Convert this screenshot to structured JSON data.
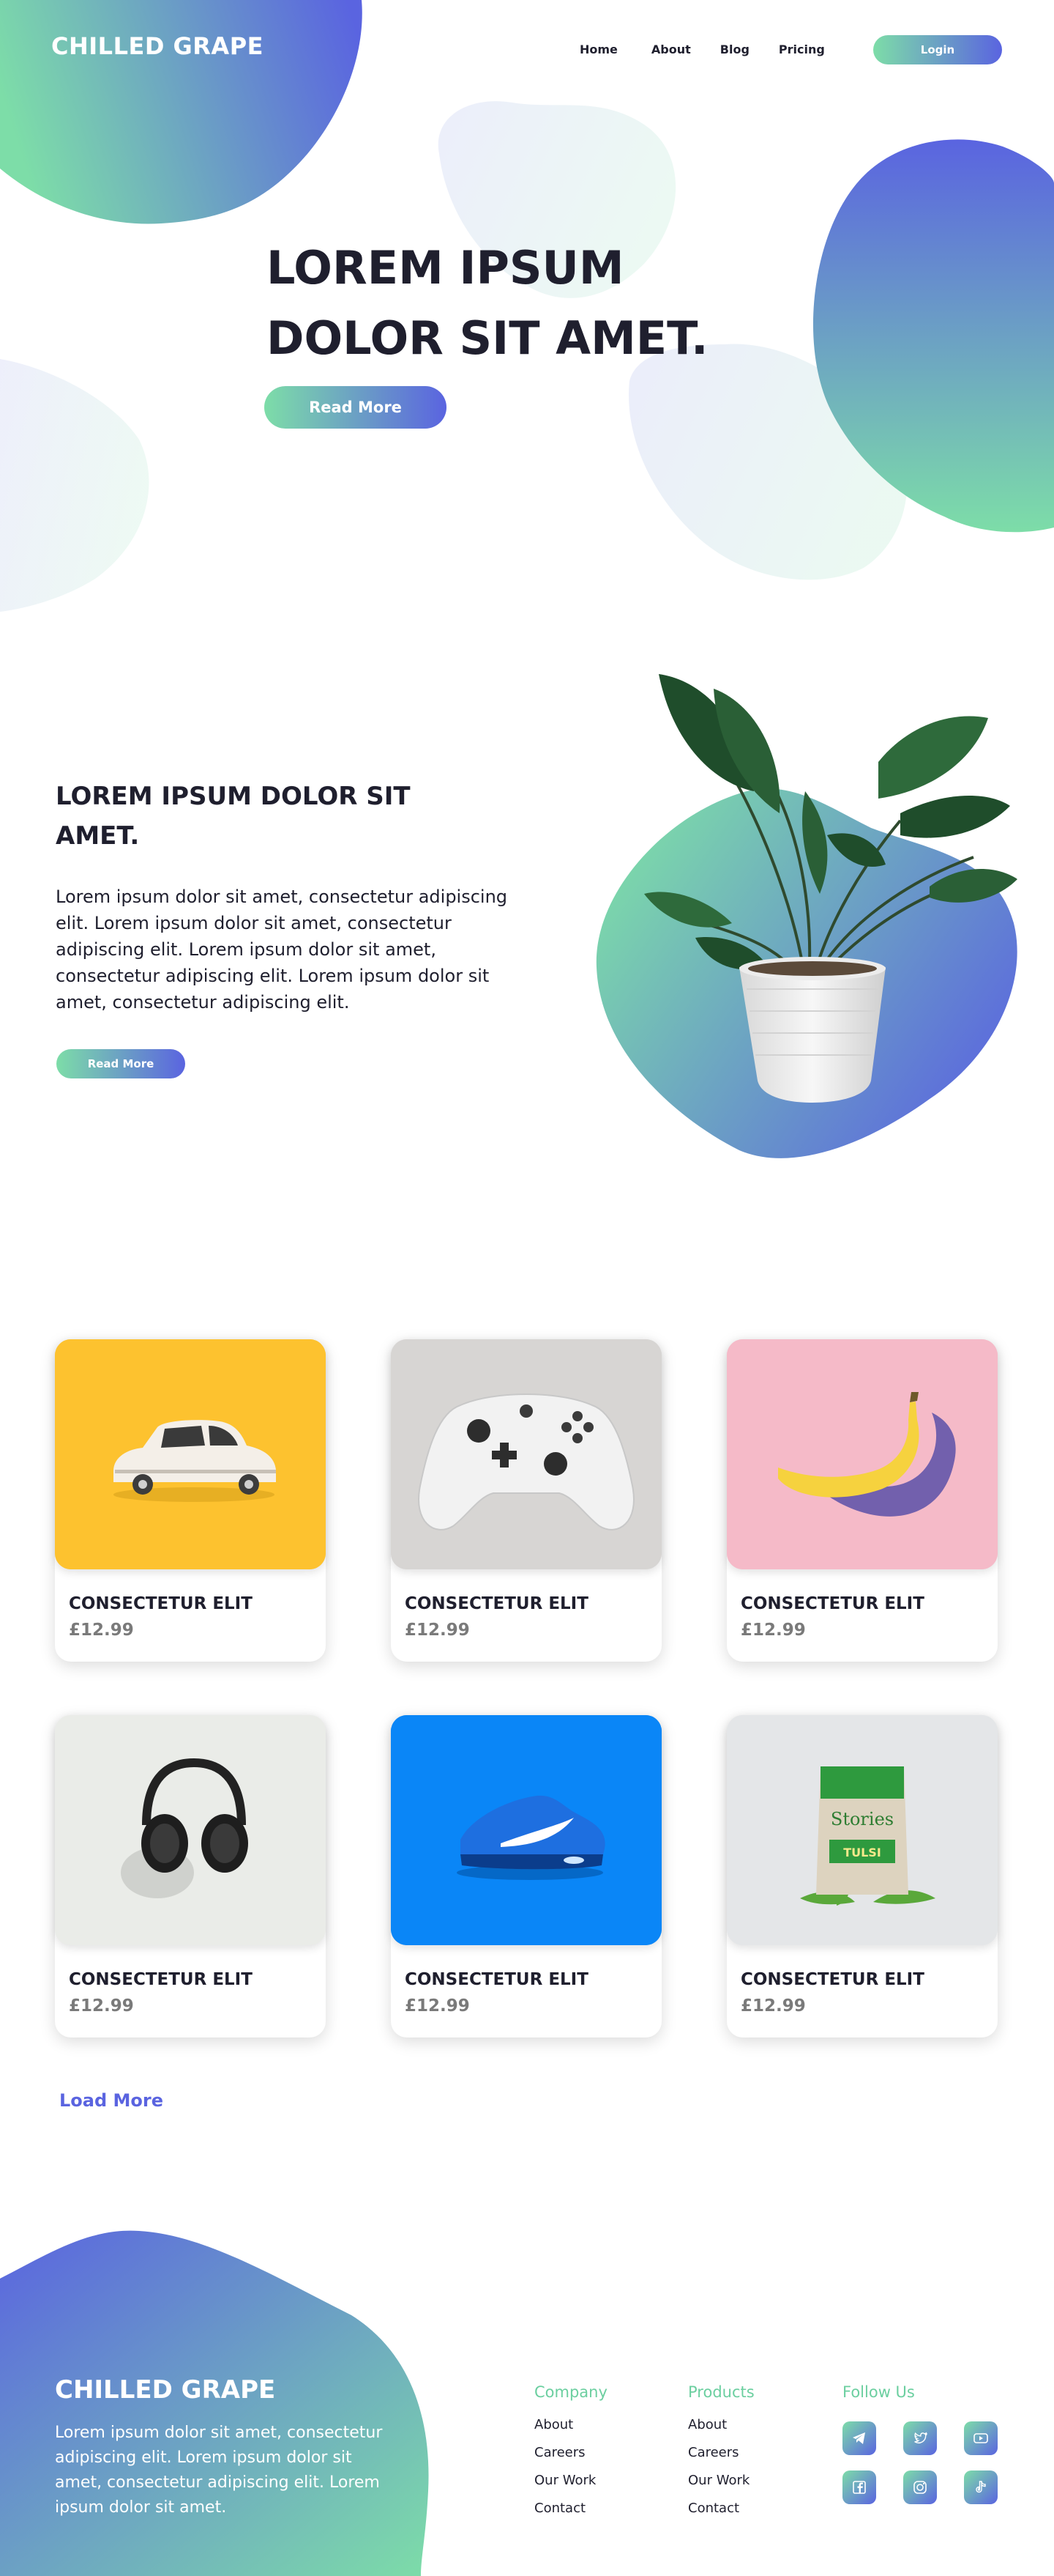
{
  "brand": {
    "name": "CHILLED GRAPE",
    "gradient_start": "#7ddda8",
    "gradient_end": "#5a64e0"
  },
  "nav": {
    "items": [
      "Home",
      "About",
      "Blog",
      "Pricing"
    ],
    "login_label": "Login"
  },
  "hero": {
    "title_line1": "LOREM IPSUM",
    "title_line2": "DOLOR SIT AMET.",
    "button_label": "Read More"
  },
  "feature": {
    "title": "LOREM IPSUM DOLOR SIT AMET.",
    "text": "Lorem ipsum dolor sit amet, consectetur adipiscing elit. Lorem ipsum dolor sit amet, consectetur adipiscing elit. Lorem ipsum dolor sit amet, consectetur adipiscing elit. Lorem ipsum dolor sit amet, consectetur adipiscing elit.",
    "button_label": "Read More",
    "image": "potted-plant"
  },
  "products": [
    {
      "title": "CONSECTETUR ELIT",
      "price": "£12.99",
      "image": "toy-car",
      "bg": "#fdbf2d"
    },
    {
      "title": "CONSECTETUR ELIT",
      "price": "£12.99",
      "image": "game-controller",
      "bg": "#d6d4d2"
    },
    {
      "title": "CONSECTETUR ELIT",
      "price": "£12.99",
      "image": "banana",
      "bg": "#f4b9c8"
    },
    {
      "title": "CONSECTETUR ELIT",
      "price": "£12.99",
      "image": "headphones",
      "bg": "#e8eae6"
    },
    {
      "title": "CONSECTETUR ELIT",
      "price": "£12.99",
      "image": "sneaker",
      "bg": "#0a84f5"
    },
    {
      "title": "CONSECTETUR ELIT",
      "price": "£12.99",
      "image": "tea-package",
      "bg": "#e3e5e7",
      "package_text1": "Stories",
      "package_text2": "TULSI"
    }
  ],
  "load_more_label": "Load More",
  "footer": {
    "brand": "CHILLED GRAPE",
    "text": "Lorem ipsum dolor sit amet, consectetur adipiscing elit. Lorem ipsum dolor sit amet, consectetur adipiscing elit. Lorem ipsum dolor sit amet.",
    "company": {
      "heading": "Company",
      "links": [
        "About",
        "Careers",
        "Our Work",
        "Contact"
      ]
    },
    "products": {
      "heading": "Products",
      "links": [
        "About",
        "Careers",
        "Our Work",
        "Contact"
      ]
    },
    "follow": {
      "heading": "Follow Us",
      "icons": [
        "telegram-icon",
        "twitter-icon",
        "youtube-icon",
        "facebook-icon",
        "instagram-icon",
        "tiktok-icon"
      ]
    }
  }
}
